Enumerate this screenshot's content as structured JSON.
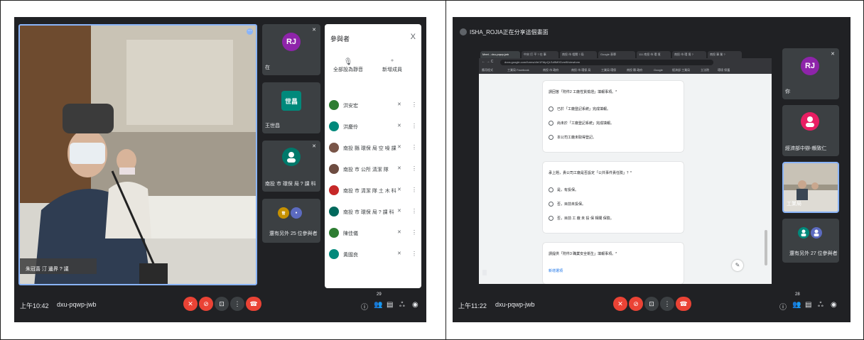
{
  "left": {
    "video_label": "朱冠喜 汀 邊界 ? 議",
    "meeting": {
      "time": "上午10:42",
      "code": "dxu-pqwp-jwb"
    },
    "tiles": [
      {
        "initials": "RJ",
        "name": "在",
        "color": "#8e24aa"
      },
      {
        "initials": "世昌",
        "name": "王世昌",
        "color": "#00897b"
      },
      {
        "initials": "",
        "name": "南投 市 環保 局 ? 課 科",
        "color": "#00796b"
      },
      {
        "initials": "",
        "name": "還有另外 25 位參與者",
        "color": "#c79100"
      }
    ],
    "panel": {
      "title": "參與者",
      "close": "X",
      "actions": [
        "全部設為靜音",
        "新增成員"
      ],
      "people": [
        {
          "initials": "",
          "name": "洪安宏",
          "color": "#2e7d32"
        },
        {
          "initials": "",
          "name": "洪慶伶",
          "color": "#00897b"
        },
        {
          "initials": "",
          "name": "南投 縣 環保 局 空 噪 課",
          "color": "#795548"
        },
        {
          "initials": "",
          "name": "南投 市 公所 清潔 隊",
          "color": "#6d4c41"
        },
        {
          "initials": "",
          "name": "南投 市 清潔 隊 土 木 科",
          "color": "#c62828"
        },
        {
          "initials": "",
          "name": "南投 市 環保 局 ? 課 科",
          "color": "#00695c"
        },
        {
          "initials": "",
          "name": "陳佳儀",
          "color": "#2e7d32"
        },
        {
          "initials": "",
          "name": "黃國良",
          "color": "#00897b"
        }
      ]
    },
    "toolbar": {
      "participants_count": "29"
    }
  },
  "right": {
    "presenting_title": "ISHA_ROJIA正在分享這個畫面",
    "meeting": {
      "time": "上午11:22",
      "code": "dxu-pqwp-jwb"
    },
    "tiles": [
      {
        "initials": "RJ",
        "name": "你",
        "color": "#8e24aa"
      },
      {
        "initials": "",
        "name": "經濟部中辦-賴致仁",
        "color": "#e91e63"
      },
      {
        "initials": "",
        "name": "工業局",
        "color": "#000"
      },
      {
        "initials": "",
        "name": "還有另外 27 位參與者",
        "color": "#c79100"
      }
    ],
    "browser": {
      "tabs": [
        "Meet - dxu-pqwp-jwb",
        "中央 打 平 ? 在 事",
        "南投 市 相關 ? 局",
        "Google 表單",
        "111 南投 市 環 境",
        "南投 市 環 境 ?",
        "南投 事 業 ?"
      ],
      "url": "docs.google.com/forms/d/e/1FAIpQLSd9M9Gvm9l/viewform",
      "bookmarks": [
        "應用程式",
        "工業局 Facebook",
        "南投 市 政府",
        "南投 市 環保 局",
        "工業局 環保",
        "南投 縣 政府",
        "Google",
        "經濟部 工業局",
        "立法院",
        "環境 保護"
      ],
      "questions": [
        {
          "text": "請回答「附件2 工廠性質檢證」填報事項。*",
          "options": [
            "已於「工廠登記系統」完成填報。",
            "尚未於「工廠登記系統」完成填報。",
            "本公司工廠未取得登記。"
          ]
        },
        {
          "text": "承上題，貴公司工廠是否設定「公共事件責任險」？*",
          "options": [
            "是，有投保。",
            "否，目前未投保。",
            "否，目前 工 廠 未 投 保 相關 保險。"
          ]
        },
        {
          "text": "請提供「附件3 職業安全衛生」填報事項。*",
          "options": [
            "新增選項"
          ]
        }
      ]
    },
    "toolbar": {
      "participants_count": "28"
    }
  }
}
